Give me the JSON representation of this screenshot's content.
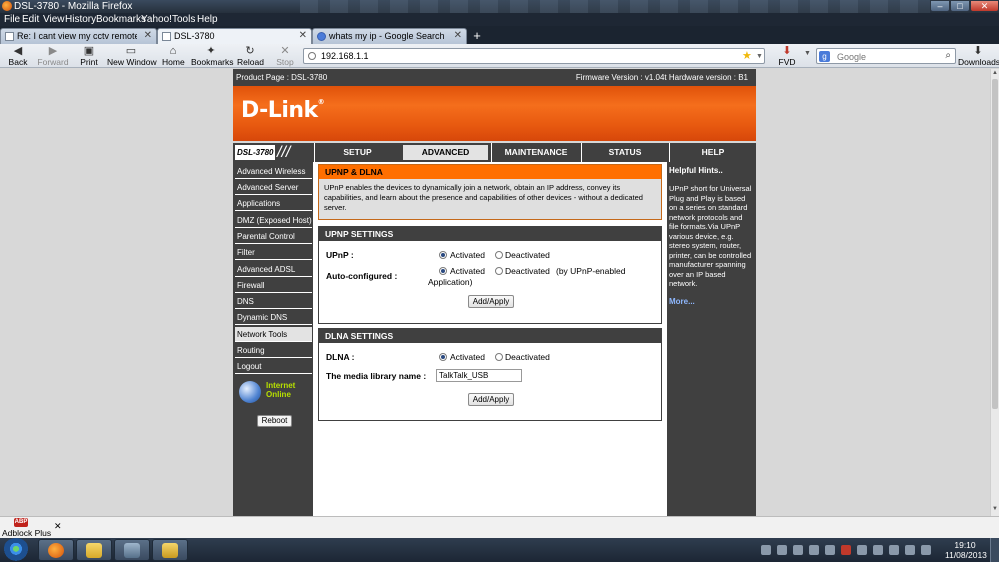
{
  "window": {
    "title": "DSL-3780 - Mozilla Firefox"
  },
  "menu": [
    "File",
    "Edit",
    "View",
    "History",
    "Bookmarks",
    "Yahoo!",
    "Tools",
    "Help"
  ],
  "tabs": [
    {
      "label": "Re: I cant view my cctv remotely sinc...",
      "active": false
    },
    {
      "label": "DSL-3780",
      "active": true
    },
    {
      "label": "whats my ip - Google Search",
      "active": false
    }
  ],
  "toolbar": {
    "back": "Back",
    "forward": "Forward",
    "print": "Print",
    "new_window": "New Window",
    "home": "Home",
    "bookmarks": "Bookmarks",
    "reload": "Reload",
    "stop": "Stop",
    "fvd": "FVD",
    "downloads": "Downloads"
  },
  "url": "192.168.1.1",
  "search": {
    "placeholder": "Google"
  },
  "router": {
    "product": "Product Page : DSL-3780",
    "firmware": "Firmware Version : v1.04t   Hardware version : B1",
    "logo": "D-Link",
    "model": "DSL-3780",
    "nav": [
      "SETUP",
      "ADVANCED",
      "MAINTENANCE",
      "STATUS",
      "HELP"
    ],
    "active_nav": "ADVANCED",
    "sidebar": [
      "Advanced Wireless",
      "Advanced Server",
      "Applications",
      "DMZ (Exposed Host)",
      "Parental Control",
      "Filter",
      "Advanced ADSL",
      "Firewall",
      "DNS",
      "Dynamic DNS",
      "Network Tools",
      "Routing",
      "Logout"
    ],
    "active_sidebar": "Network Tools",
    "internet": {
      "line1": "Internet",
      "line2": "Online"
    },
    "reboot": "Reboot",
    "intro": {
      "title": "UPNP & DLNA",
      "text": "UPnP enables the devices to dynamically join a network, obtain an IP address, convey its capabilities, and learn about the presence and capabilities of other devices - without a dedicated server."
    },
    "upnp": {
      "title": "UPNP SETTINGS",
      "upnp_label": "UPnP :",
      "auto_label": "Auto-configured :",
      "activated": "Activated",
      "deactivated": "Deactivated",
      "auto_note": "(by UPnP-enabled",
      "auto_note2": "Application)",
      "apply": "Add/Apply"
    },
    "dlna": {
      "title": "DLNA SETTINGS",
      "dlna_label": "DLNA :",
      "library_label": "The media library name :",
      "library_value": "TalkTalk_USB",
      "activated": "Activated",
      "deactivated": "Deactivated",
      "apply": "Add/Apply"
    },
    "hints": {
      "title": "Helpful Hints..",
      "body": "UPnP short for Universal Plug and Play is based on a series on standard network protocols and file formats.Via UPnP various device, e.g. stereo system, router, printer, can be controlled manufacturer spanning over an IP based network.",
      "more": "More..."
    }
  },
  "addon": {
    "label": "Adblock Plus",
    "icon_text": "ABP"
  },
  "clock": {
    "time": "19:10",
    "date": "11/08/2013"
  }
}
